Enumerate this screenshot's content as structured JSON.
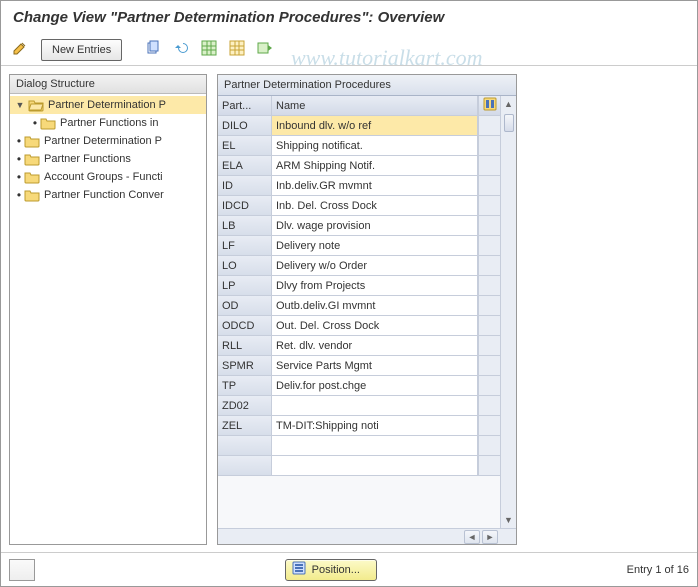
{
  "title": "Change View \"Partner Determination Procedures\": Overview",
  "toolbar": {
    "new_entries_label": "New Entries",
    "icons": [
      "pencil-icon",
      "copy-icon",
      "undo-icon",
      "clipboard-icon",
      "grid-icon",
      "export-icon"
    ]
  },
  "dialog_structure": {
    "header": "Dialog Structure",
    "nodes": [
      {
        "label": "Partner Determination P",
        "level": 0,
        "expanded": true,
        "selected": true,
        "open": true
      },
      {
        "label": "Partner Functions in",
        "level": 1,
        "bullet": true
      },
      {
        "label": "Partner Determination P",
        "level": 0,
        "bullet": true
      },
      {
        "label": "Partner Functions",
        "level": 0,
        "bullet": true
      },
      {
        "label": "Account Groups - Functi",
        "level": 0,
        "bullet": true
      },
      {
        "label": "Partner Function Conver",
        "level": 0,
        "bullet": true
      }
    ]
  },
  "table": {
    "title": "Partner Determination Procedures",
    "columns": {
      "part": "Part...",
      "name": "Name"
    },
    "rows": [
      {
        "part": "DILO",
        "name": "Inbound dlv. w/o ref",
        "highlight": true
      },
      {
        "part": "EL",
        "name": "Shipping notificat."
      },
      {
        "part": "ELA",
        "name": "ARM Shipping Notif."
      },
      {
        "part": "ID",
        "name": "Inb.deliv.GR mvmnt"
      },
      {
        "part": "IDCD",
        "name": "Inb. Del. Cross Dock"
      },
      {
        "part": "LB",
        "name": "Dlv. wage provision"
      },
      {
        "part": "LF",
        "name": "Delivery note"
      },
      {
        "part": "LO",
        "name": "Delivery w/o Order"
      },
      {
        "part": "LP",
        "name": "Dlvy from Projects"
      },
      {
        "part": "OD",
        "name": "Outb.deliv.GI mvmnt"
      },
      {
        "part": "ODCD",
        "name": "Out. Del. Cross Dock"
      },
      {
        "part": "RLL",
        "name": "Ret. dlv. vendor"
      },
      {
        "part": "SPMR",
        "name": "Service Parts Mgmt"
      },
      {
        "part": "TP",
        "name": "Deliv.for post.chge"
      },
      {
        "part": "ZD02",
        "name": ""
      },
      {
        "part": "ZEL",
        "name": "TM-DIT:Shipping noti"
      },
      {
        "part": "",
        "name": "",
        "empty": true
      },
      {
        "part": "",
        "name": "",
        "empty": true
      }
    ]
  },
  "footer": {
    "position_label": "Position...",
    "entry_info": "Entry 1 of 16"
  },
  "watermark": "www.tutorialkart.com"
}
